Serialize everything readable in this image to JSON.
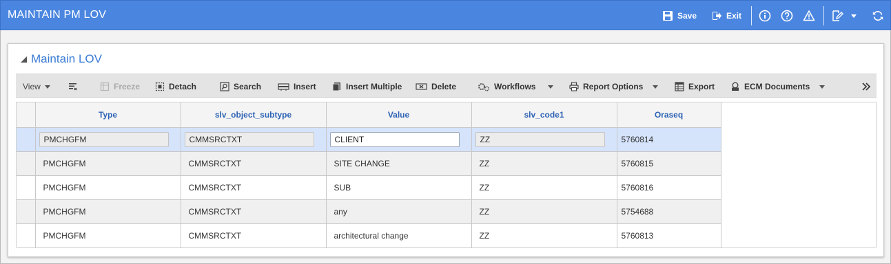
{
  "app": {
    "title": "MAINTAIN PM LOV"
  },
  "header_actions": {
    "save_label": "Save",
    "exit_label": "Exit"
  },
  "panel": {
    "title": "Maintain LOV"
  },
  "toolbar": {
    "view_label": "View",
    "freeze_label": "Freeze",
    "detach_label": "Detach",
    "search_label": "Search",
    "insert_label": "Insert",
    "insert_multiple_label": "Insert Multiple",
    "delete_label": "Delete",
    "workflows_label": "Workflows",
    "report_options_label": "Report Options",
    "export_label": "Export",
    "ecm_documents_label": "ECM Documents"
  },
  "table": {
    "columns": [
      "Type",
      "slv_object_subtype",
      "Value",
      "slv_code1",
      "Oraseq"
    ],
    "rows": [
      {
        "type": "PMCHGFM",
        "subtype": "CMMSRCTXT",
        "value": "CLIENT",
        "code1": "ZZ",
        "oraseq": "5760814"
      },
      {
        "type": "PMCHGFM",
        "subtype": "CMMSRCTXT",
        "value": "SITE CHANGE",
        "code1": "ZZ",
        "oraseq": "5760815"
      },
      {
        "type": "PMCHGFM",
        "subtype": "CMMSRCTXT",
        "value": "SUB",
        "code1": "ZZ",
        "oraseq": "5760816"
      },
      {
        "type": "PMCHGFM",
        "subtype": "CMMSRCTXT",
        "value": "any",
        "code1": "ZZ",
        "oraseq": "5754688"
      },
      {
        "type": "PMCHGFM",
        "subtype": "CMMSRCTXT",
        "value": "architectural change",
        "code1": "ZZ",
        "oraseq": "5760813"
      }
    ]
  },
  "colors": {
    "header_bar": "#4a86e0",
    "title_blue": "#3a7bd5",
    "column_header_text": "#2e63b5",
    "selected_row": "#d5e3fb"
  }
}
